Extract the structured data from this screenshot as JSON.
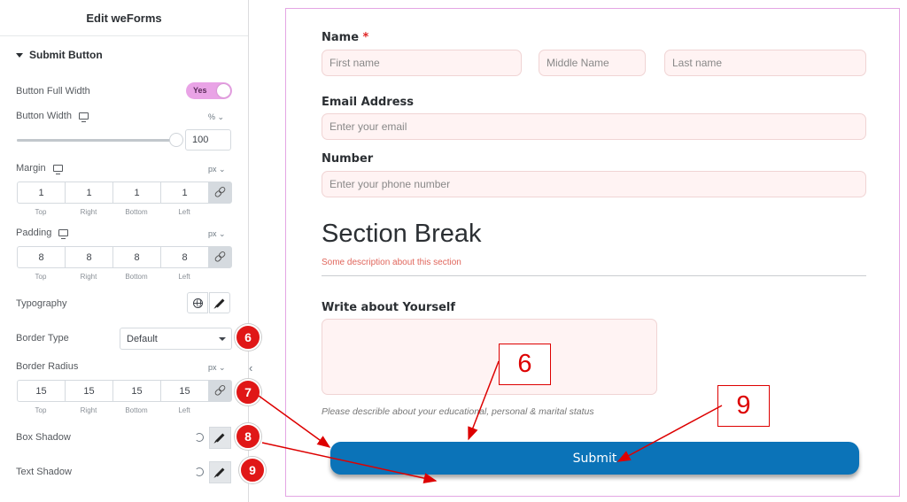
{
  "panel": {
    "title": "Edit weForms",
    "section": "Submit Button",
    "full_width": {
      "label": "Button Full Width",
      "value": "Yes"
    },
    "width": {
      "label": "Button Width",
      "unit": "%",
      "value": "100",
      "fraction": 1.0
    },
    "margin": {
      "label": "Margin",
      "unit": "px",
      "values": [
        "1",
        "1",
        "1",
        "1"
      ]
    },
    "padding": {
      "label": "Padding",
      "unit": "px",
      "values": [
        "8",
        "8",
        "8",
        "8"
      ]
    },
    "dim_labels": [
      "Top",
      "Right",
      "Bottom",
      "Left"
    ],
    "typography": {
      "label": "Typography"
    },
    "border_type": {
      "label": "Border Type",
      "value": "Default"
    },
    "border_radius": {
      "label": "Border Radius",
      "unit": "px",
      "values": [
        "15",
        "15",
        "15",
        "15"
      ]
    },
    "box_shadow": {
      "label": "Box Shadow"
    },
    "text_shadow": {
      "label": "Text Shadow"
    },
    "collapse_glyph": "‹"
  },
  "badges": [
    "6",
    "7",
    "8",
    "9"
  ],
  "callouts": [
    "6",
    "9"
  ],
  "form": {
    "name_label": "Name",
    "required_mark": "*",
    "first_placeholder": "First name",
    "middle_placeholder": "Middle Name",
    "last_placeholder": "Last name",
    "email_label": "Email Address",
    "email_placeholder": "Enter your email",
    "number_label": "Number",
    "number_placeholder": "Enter your phone number",
    "section_title": "Section Break",
    "section_desc": "Some description about this section",
    "about_label": "Write about Yourself",
    "about_help": "Please describle about your educational, personal & marital status",
    "submit": "Submit"
  },
  "colors": {
    "accent": "#0b73b8",
    "badge": "#e01717",
    "toggle": "#e9a3e6",
    "input_bg": "#fff3f3"
  }
}
